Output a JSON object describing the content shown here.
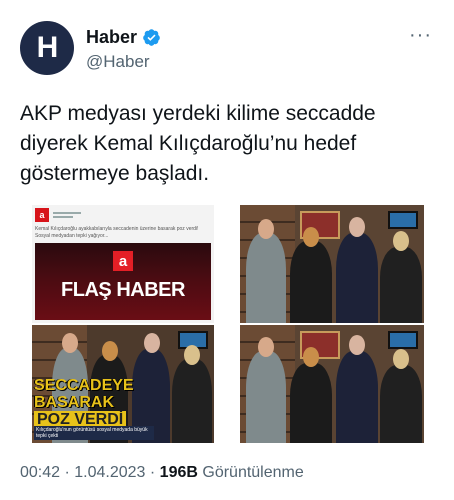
{
  "author": {
    "display_name": "Haber",
    "handle": "@Haber",
    "avatar_letter": "H",
    "avatar_color": "#1e2a47",
    "verified_icon": "verified-badge-icon",
    "verified_color": "#1d9bf0"
  },
  "tweet": {
    "text": "AKP medyası yerdeki kilime seccadde diyerek Kemal Kılıçdaroğlu’nu hedef göstermeye başladı.",
    "more_icon": "···"
  },
  "media": {
    "panel1": {
      "logo": "a",
      "snippet": "Kemal Kılıçdaroğlu ayakkabılarıyla seccadenin üzerine basarak poz verdi! Sosyal medyadan tepki yağıyor...",
      "flash_logo": "a",
      "flash_text": "FLAŞ HABER"
    },
    "panel3": {
      "line1": "SECCADEYE",
      "line2": "BASARAK",
      "line3": "POZ VERDİ",
      "caption": "Kılıçdaroğlu'nun görüntüsü sosyal medyada büyük tepki çekti"
    }
  },
  "footer": {
    "time": "00:42",
    "sep1": " · ",
    "date": "1.04.2023",
    "sep2": " · ",
    "views_count": "196B",
    "views_label": " Görüntülenme"
  }
}
